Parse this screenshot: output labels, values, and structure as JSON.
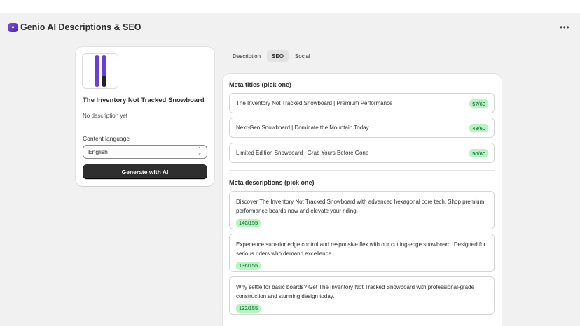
{
  "app": {
    "title": "Genio AI Descriptions & SEO",
    "icon": "sparkle-icon",
    "more_label": "•••"
  },
  "product": {
    "name": "The Inventory Not Tracked Snowboard",
    "description": "No description yet",
    "thumbnail": "snowboard-image"
  },
  "language": {
    "label": "Content language",
    "selected": "English"
  },
  "generate_button": "Generate with AI",
  "tabs": [
    {
      "label": "Description",
      "active": false
    },
    {
      "label": "SEO",
      "active": true
    },
    {
      "label": "Social",
      "active": false
    }
  ],
  "seo": {
    "titles_heading": "Meta titles (pick one)",
    "titles": [
      {
        "text": "The Inventory Not Tracked Snowboard | Premium Performance",
        "count": "57/60"
      },
      {
        "text": "Next-Gen Snowboard | Dominate the Mountain Today",
        "count": "48/60"
      },
      {
        "text": "Limited Edition Snowboard | Grab Yours Before Gone",
        "count": "50/60"
      }
    ],
    "descriptions_heading": "Meta descriptions (pick one)",
    "descriptions": [
      {
        "text": "Discover The Inventory Not Tracked Snowboard with advanced hexagonal core tech. Shop premium performance boards now and elevate your riding.",
        "count": "140/155"
      },
      {
        "text": "Experience superior edge control and responsive flex with our cutting-edge snowboard. Designed for serious riders who demand excellence.",
        "count": "136/155"
      },
      {
        "text": "Why settle for basic boards? Get The Inventory Not Tracked Snowboard with professional-grade construction and stunning design today.",
        "count": "132/155"
      }
    ]
  },
  "colors": {
    "background": "#f1f1f1",
    "badge_bg": "#b4f5c0",
    "button_bg": "#2e2e2e",
    "board": "#6a3fd8"
  }
}
